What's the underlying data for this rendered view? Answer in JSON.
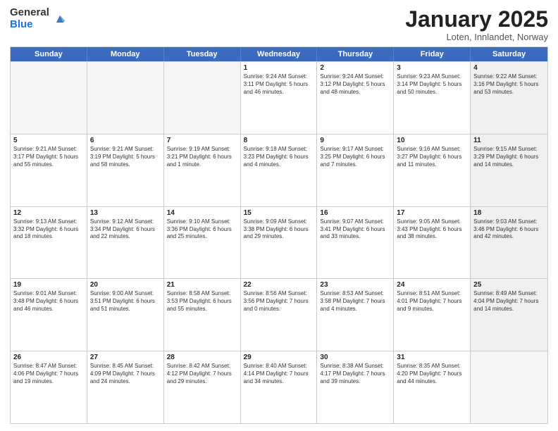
{
  "logo": {
    "general": "General",
    "blue": "Blue"
  },
  "header": {
    "month": "January 2025",
    "location": "Loten, Innlandet, Norway"
  },
  "days_of_week": [
    "Sunday",
    "Monday",
    "Tuesday",
    "Wednesday",
    "Thursday",
    "Friday",
    "Saturday"
  ],
  "weeks": [
    [
      {
        "num": "",
        "info": "",
        "empty": true
      },
      {
        "num": "",
        "info": "",
        "empty": true
      },
      {
        "num": "",
        "info": "",
        "empty": true
      },
      {
        "num": "1",
        "info": "Sunrise: 9:24 AM\nSunset: 3:11 PM\nDaylight: 5 hours and 46 minutes.",
        "empty": false
      },
      {
        "num": "2",
        "info": "Sunrise: 9:24 AM\nSunset: 3:12 PM\nDaylight: 5 hours and 48 minutes.",
        "empty": false
      },
      {
        "num": "3",
        "info": "Sunrise: 9:23 AM\nSunset: 3:14 PM\nDaylight: 5 hours and 50 minutes.",
        "empty": false
      },
      {
        "num": "4",
        "info": "Sunrise: 9:22 AM\nSunset: 3:16 PM\nDaylight: 5 hours and 53 minutes.",
        "empty": false,
        "shaded": true
      }
    ],
    [
      {
        "num": "5",
        "info": "Sunrise: 9:21 AM\nSunset: 3:17 PM\nDaylight: 5 hours and 55 minutes.",
        "empty": false
      },
      {
        "num": "6",
        "info": "Sunrise: 9:21 AM\nSunset: 3:19 PM\nDaylight: 5 hours and 58 minutes.",
        "empty": false
      },
      {
        "num": "7",
        "info": "Sunrise: 9:19 AM\nSunset: 3:21 PM\nDaylight: 6 hours and 1 minute.",
        "empty": false
      },
      {
        "num": "8",
        "info": "Sunrise: 9:18 AM\nSunset: 3:23 PM\nDaylight: 6 hours and 4 minutes.",
        "empty": false
      },
      {
        "num": "9",
        "info": "Sunrise: 9:17 AM\nSunset: 3:25 PM\nDaylight: 6 hours and 7 minutes.",
        "empty": false
      },
      {
        "num": "10",
        "info": "Sunrise: 9:16 AM\nSunset: 3:27 PM\nDaylight: 6 hours and 11 minutes.",
        "empty": false
      },
      {
        "num": "11",
        "info": "Sunrise: 9:15 AM\nSunset: 3:29 PM\nDaylight: 6 hours and 14 minutes.",
        "empty": false,
        "shaded": true
      }
    ],
    [
      {
        "num": "12",
        "info": "Sunrise: 9:13 AM\nSunset: 3:32 PM\nDaylight: 6 hours and 18 minutes.",
        "empty": false
      },
      {
        "num": "13",
        "info": "Sunrise: 9:12 AM\nSunset: 3:34 PM\nDaylight: 6 hours and 22 minutes.",
        "empty": false
      },
      {
        "num": "14",
        "info": "Sunrise: 9:10 AM\nSunset: 3:36 PM\nDaylight: 6 hours and 25 minutes.",
        "empty": false
      },
      {
        "num": "15",
        "info": "Sunrise: 9:09 AM\nSunset: 3:38 PM\nDaylight: 6 hours and 29 minutes.",
        "empty": false
      },
      {
        "num": "16",
        "info": "Sunrise: 9:07 AM\nSunset: 3:41 PM\nDaylight: 6 hours and 33 minutes.",
        "empty": false
      },
      {
        "num": "17",
        "info": "Sunrise: 9:05 AM\nSunset: 3:43 PM\nDaylight: 6 hours and 38 minutes.",
        "empty": false
      },
      {
        "num": "18",
        "info": "Sunrise: 9:03 AM\nSunset: 3:46 PM\nDaylight: 6 hours and 42 minutes.",
        "empty": false,
        "shaded": true
      }
    ],
    [
      {
        "num": "19",
        "info": "Sunrise: 9:01 AM\nSunset: 3:48 PM\nDaylight: 6 hours and 46 minutes.",
        "empty": false
      },
      {
        "num": "20",
        "info": "Sunrise: 9:00 AM\nSunset: 3:51 PM\nDaylight: 6 hours and 51 minutes.",
        "empty": false
      },
      {
        "num": "21",
        "info": "Sunrise: 8:58 AM\nSunset: 3:53 PM\nDaylight: 6 hours and 55 minutes.",
        "empty": false
      },
      {
        "num": "22",
        "info": "Sunrise: 8:56 AM\nSunset: 3:56 PM\nDaylight: 7 hours and 0 minutes.",
        "empty": false
      },
      {
        "num": "23",
        "info": "Sunrise: 8:53 AM\nSunset: 3:58 PM\nDaylight: 7 hours and 4 minutes.",
        "empty": false
      },
      {
        "num": "24",
        "info": "Sunrise: 8:51 AM\nSunset: 4:01 PM\nDaylight: 7 hours and 9 minutes.",
        "empty": false
      },
      {
        "num": "25",
        "info": "Sunrise: 8:49 AM\nSunset: 4:04 PM\nDaylight: 7 hours and 14 minutes.",
        "empty": false,
        "shaded": true
      }
    ],
    [
      {
        "num": "26",
        "info": "Sunrise: 8:47 AM\nSunset: 4:06 PM\nDaylight: 7 hours and 19 minutes.",
        "empty": false
      },
      {
        "num": "27",
        "info": "Sunrise: 8:45 AM\nSunset: 4:09 PM\nDaylight: 7 hours and 24 minutes.",
        "empty": false
      },
      {
        "num": "28",
        "info": "Sunrise: 8:42 AM\nSunset: 4:12 PM\nDaylight: 7 hours and 29 minutes.",
        "empty": false
      },
      {
        "num": "29",
        "info": "Sunrise: 8:40 AM\nSunset: 4:14 PM\nDaylight: 7 hours and 34 minutes.",
        "empty": false
      },
      {
        "num": "30",
        "info": "Sunrise: 8:38 AM\nSunset: 4:17 PM\nDaylight: 7 hours and 39 minutes.",
        "empty": false
      },
      {
        "num": "31",
        "info": "Sunrise: 8:35 AM\nSunset: 4:20 PM\nDaylight: 7 hours and 44 minutes.",
        "empty": false
      },
      {
        "num": "",
        "info": "",
        "empty": true,
        "shaded": true
      }
    ]
  ]
}
